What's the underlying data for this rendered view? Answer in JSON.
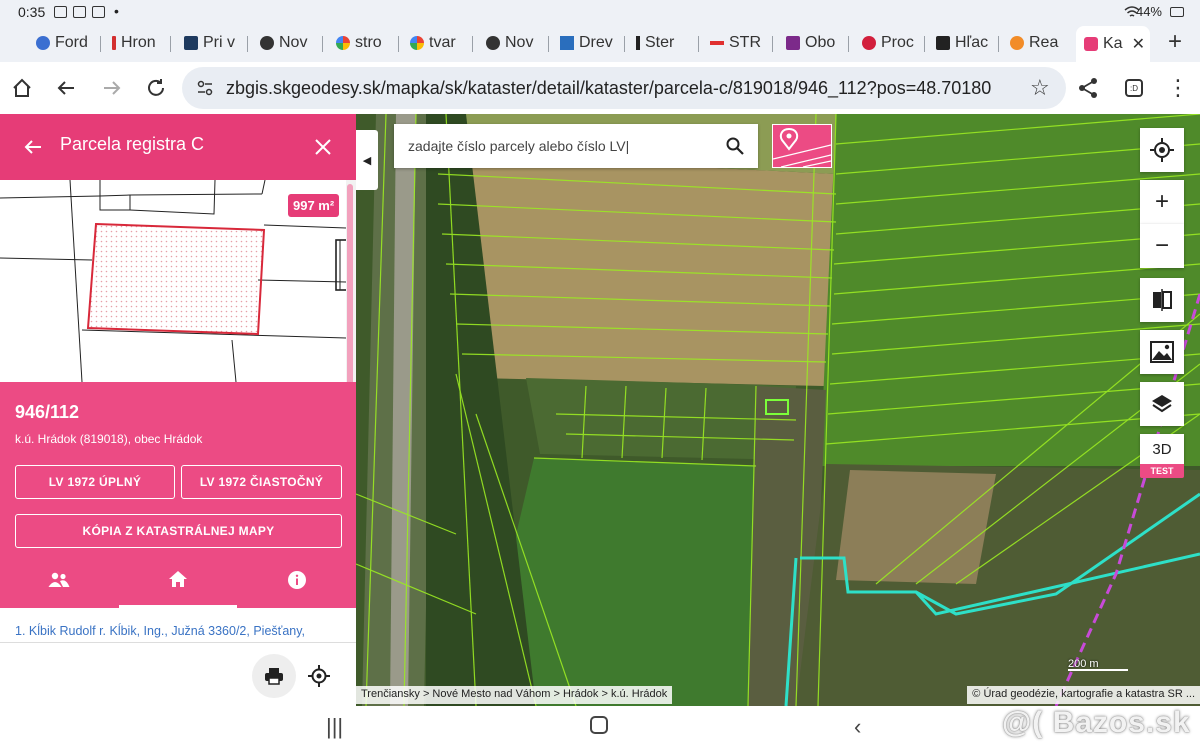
{
  "status_bar": {
    "time": "0:35",
    "dot": "•",
    "battery": "44%"
  },
  "tabs": [
    {
      "label": "Ford",
      "color": "#3b6fd1"
    },
    {
      "label": "Hron",
      "color": "#d32f2f"
    },
    {
      "label": "Pri v",
      "color": "#1e3a5f"
    },
    {
      "label": "Nov",
      "color": "#333333"
    },
    {
      "label": "stro",
      "color": "#4285f4"
    },
    {
      "label": "tvar",
      "color": "#4285f4"
    },
    {
      "label": "Nov",
      "color": "#333333"
    },
    {
      "label": "Drev",
      "color": "#2a6ebd"
    },
    {
      "label": "Ster",
      "color": "#222222"
    },
    {
      "label": "STR",
      "color": "#e03030"
    },
    {
      "label": "Obo",
      "color": "#7c2a8a"
    },
    {
      "label": "Proc",
      "color": "#d21f3c"
    },
    {
      "label": "Hľac",
      "color": "#222222"
    },
    {
      "label": "Rea",
      "color": "#f28c28"
    },
    {
      "label": "Ka",
      "color": "#e63c77"
    }
  ],
  "address_bar": {
    "url": "zbgis.skgeodesy.sk/mapka/sk/kataster/detail/kataster/parcela-c/819018/946_112?pos=48.70180"
  },
  "panel": {
    "title": "Parcela registra C",
    "area": "997 m²",
    "parcel_number": "946/112",
    "location": "k.ú. Hrádok (819018), obec Hrádok",
    "btn_lv_full": "LV 1972 ÚPLNÝ",
    "btn_lv_partial": "LV 1972 ČIASTOČNÝ",
    "btn_copy": "KÓPIA Z KATASTRÁLNEJ MAPY",
    "owner": "1. Kĺbik Rudolf r. Kĺbik, Ing., Južná 3360/2, Piešťany,"
  },
  "map": {
    "search_placeholder": "zadajte číslo parcely alebo číslo LV|",
    "btn_3d": "3D",
    "badge_test": "TEST",
    "scale": "200 m",
    "breadcrumb": "Trenčiansky > Nové Mesto nad Váhom > Hrádok > k.ú. Hrádok",
    "copyright": "© Úrad geodézie, kartografie a katastra SR ..."
  },
  "watermark": "@( Bazos.sk",
  "colors": {
    "accent": "#e63c77",
    "accent_light": "#ec4b84",
    "link": "#3a73c4"
  }
}
